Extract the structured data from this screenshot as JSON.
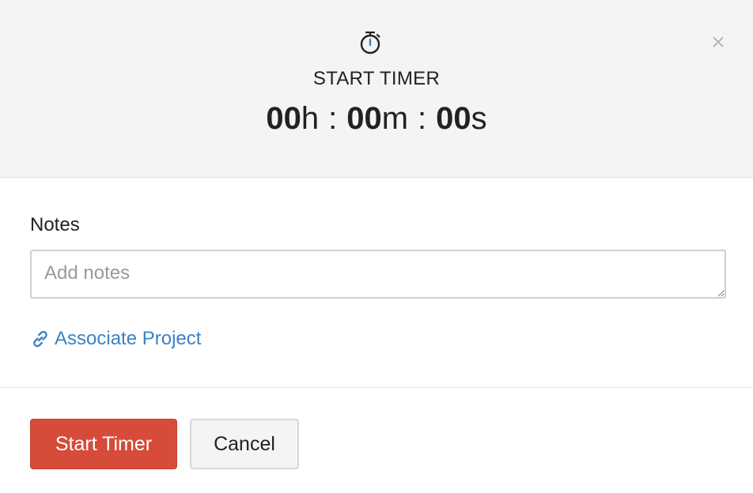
{
  "header": {
    "title": "START TIMER",
    "clock": {
      "hours": "00",
      "hours_unit": "h",
      "minutes": "00",
      "minutes_unit": "m",
      "seconds": "00",
      "seconds_unit": "s",
      "separator": ":"
    },
    "timer_icon": "stopwatch-icon",
    "close_icon": "close-icon",
    "close_glyph": "×"
  },
  "notes": {
    "label": "Notes",
    "placeholder": "Add notes",
    "value": ""
  },
  "associate": {
    "icon": "link-icon",
    "label": "Associate Project"
  },
  "footer": {
    "start_label": "Start Timer",
    "cancel_label": "Cancel"
  },
  "colors": {
    "header_bg": "#f4f4f4",
    "primary": "#d64b3a",
    "link": "#3b82c4",
    "timer_icon_accent": "#3b82c4"
  }
}
